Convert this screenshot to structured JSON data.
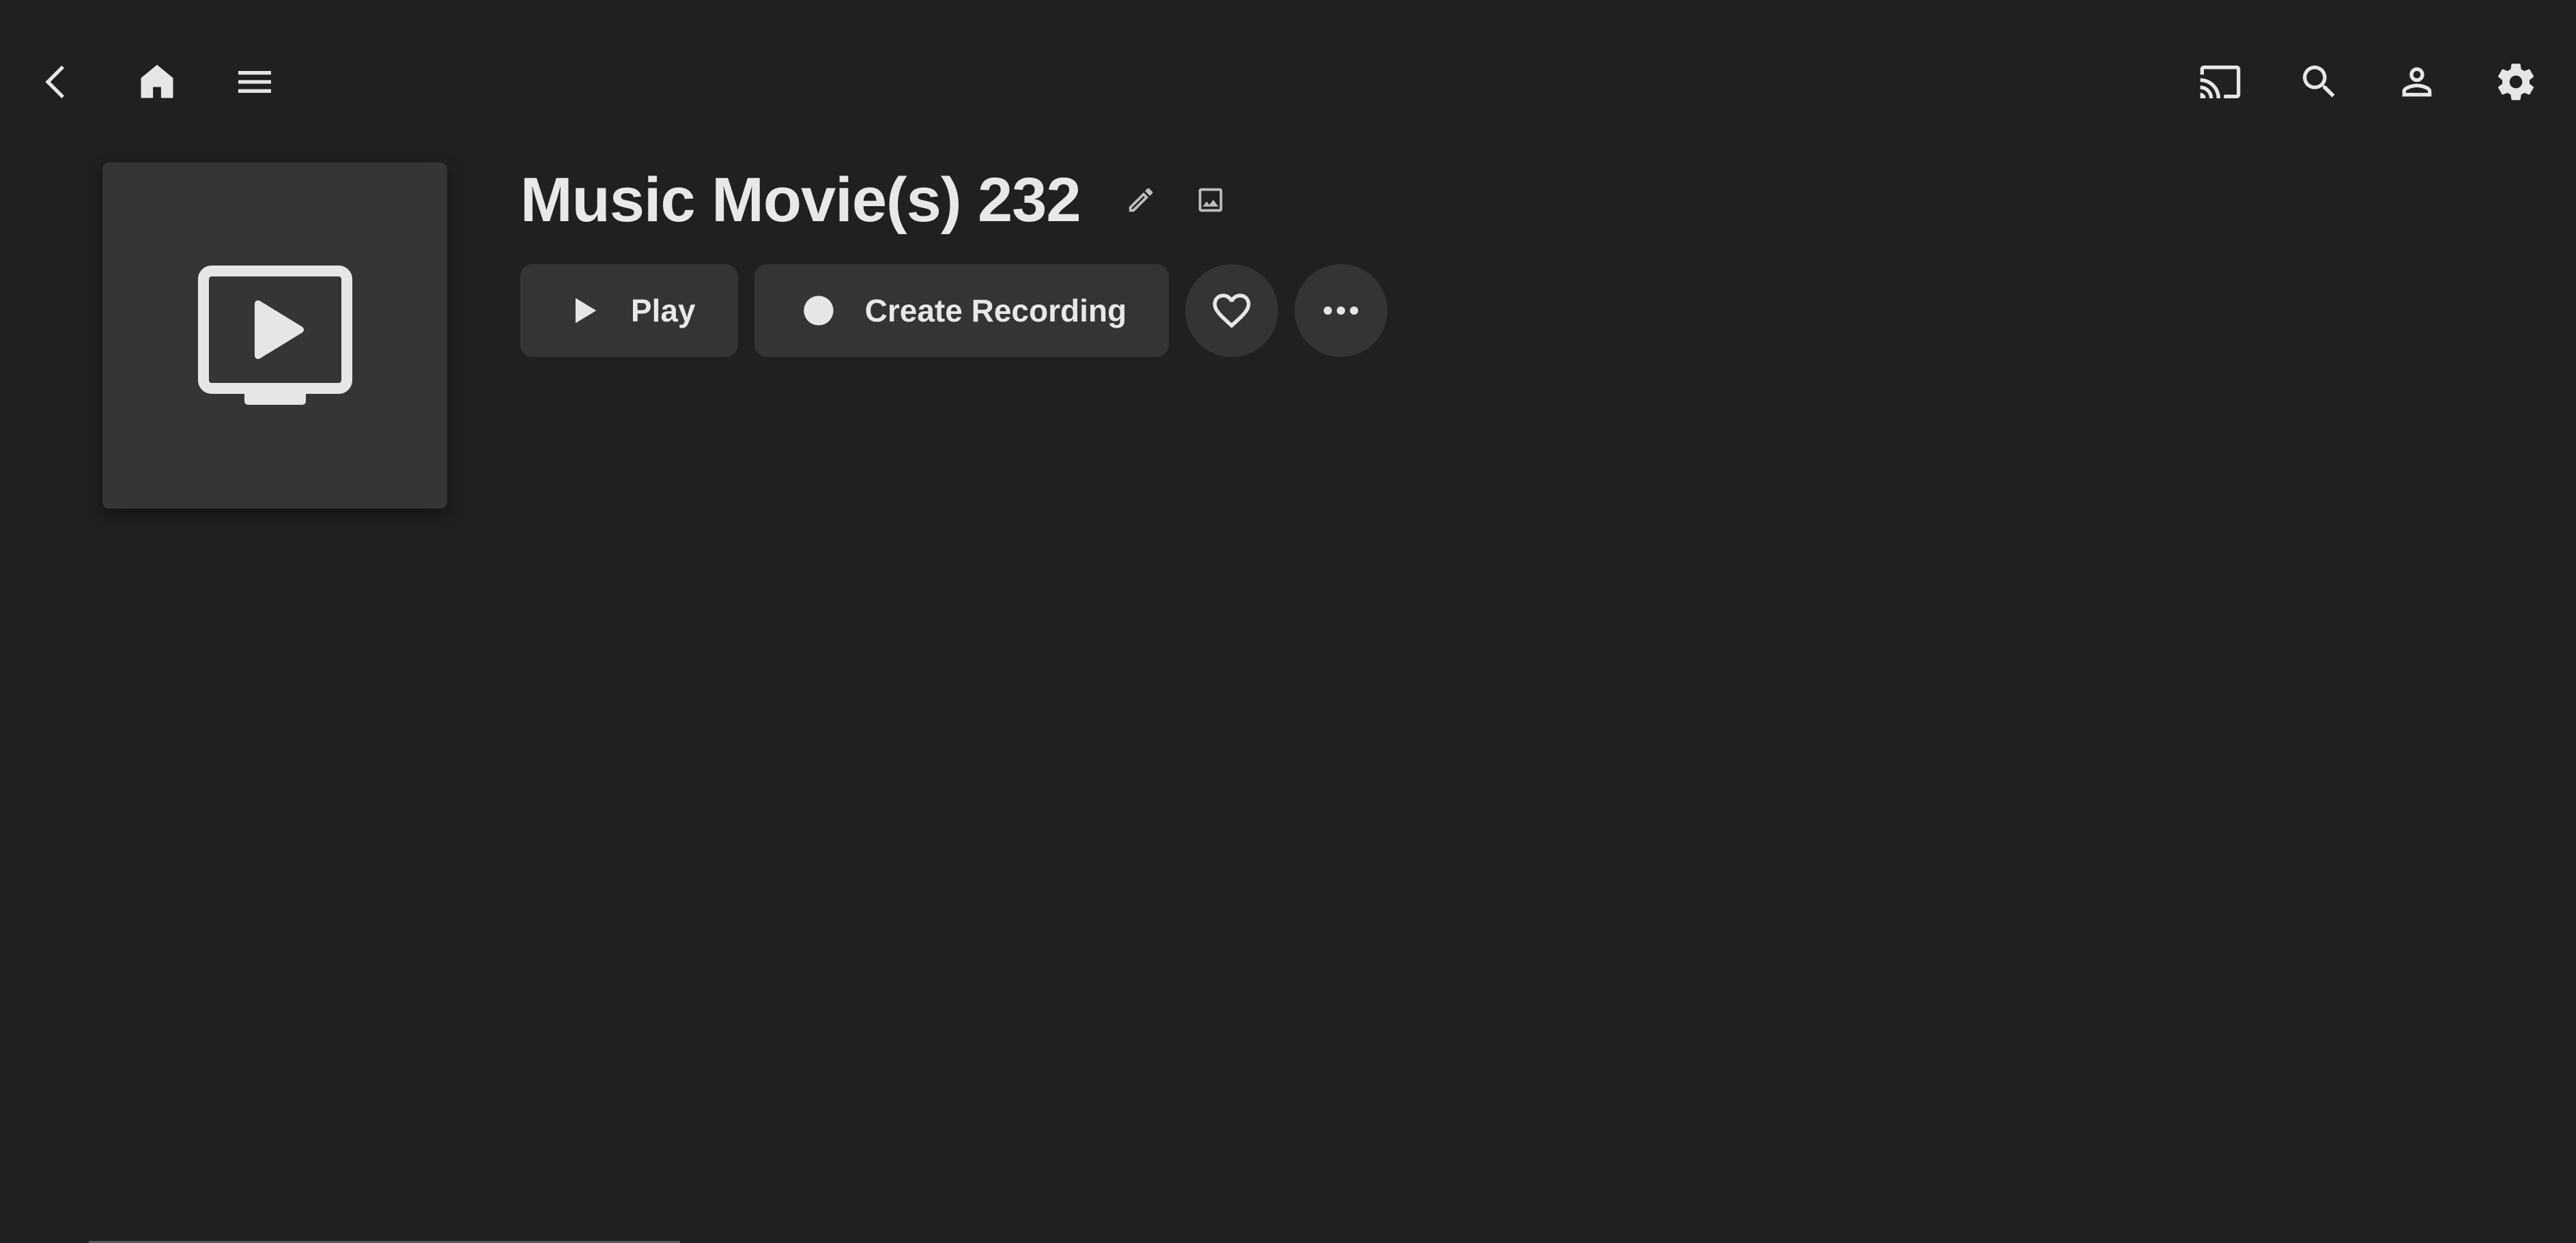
{
  "topbar": {
    "left_icons": [
      "back-icon",
      "home-icon",
      "menu-icon"
    ],
    "right_icons": [
      "cast-icon",
      "search-icon",
      "user-icon",
      "settings-icon"
    ]
  },
  "item": {
    "title": "Music Movie(s) 232",
    "poster_icon": "tv-play-icon"
  },
  "actions": {
    "play_label": "Play",
    "create_recording_label": "Create Recording",
    "favorite_icon": "heart-icon",
    "more_icon": "more-horizontal-icon"
  },
  "colors": {
    "background": "#202020",
    "surface": "#343434",
    "text": "#e6e6e6"
  }
}
